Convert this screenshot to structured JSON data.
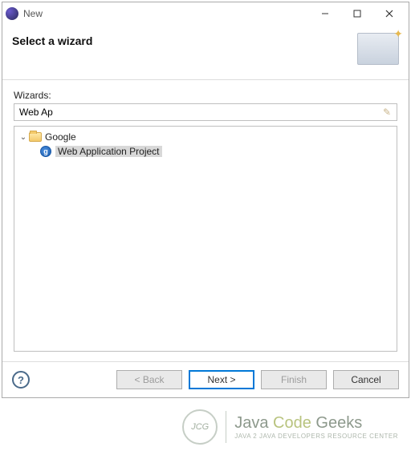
{
  "titlebar": {
    "title": "New"
  },
  "banner": {
    "title": "Select a wizard"
  },
  "filter": {
    "label": "Wizards:",
    "value": "Web Ap"
  },
  "tree": {
    "root": {
      "label": "Google",
      "expanded": true
    },
    "child": {
      "label": "Web Application Project",
      "selected": true
    }
  },
  "buttons": {
    "back": "< Back",
    "next": "Next >",
    "finish": "Finish",
    "cancel": "Cancel"
  },
  "watermark": {
    "badge": "JCG",
    "brand_java": "Java",
    "brand_code": "Code",
    "brand_geeks": "Geeks",
    "tagline": "JAVA 2 JAVA DEVELOPERS RESOURCE CENTER"
  }
}
